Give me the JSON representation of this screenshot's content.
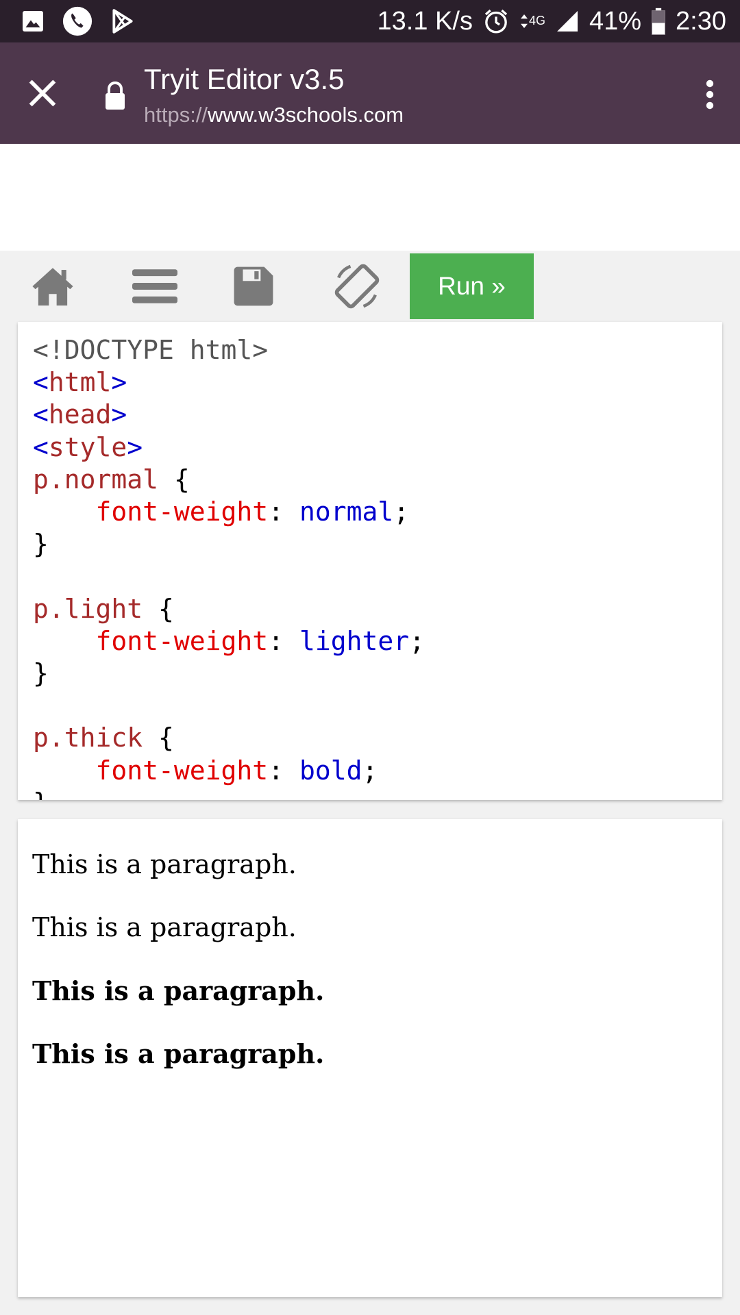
{
  "status_bar": {
    "net_speed": "13.1 K/s",
    "network": "4G",
    "battery": "41%",
    "time": "2:30",
    "icons": [
      "image-icon",
      "phone-icon",
      "play-store-icon",
      "alarm-icon",
      "data-arrows-icon",
      "signal-icon",
      "battery-icon"
    ]
  },
  "browser": {
    "title": "Tryit Editor v3.5",
    "url_scheme": "https://",
    "url_host": "www.w3schools.com"
  },
  "editor_toolbar": {
    "icons": [
      "home-icon",
      "menu-icon",
      "save-icon",
      "rotate-icon"
    ],
    "run_label": "Run »"
  },
  "code": {
    "l1": "<!DOCTYPE html>",
    "l2_open": "<",
    "l2_tag": "html",
    "l2_close": ">",
    "l3_open": "<",
    "l3_tag": "head",
    "l3_close": ">",
    "l4_open": "<",
    "l4_tag": "style",
    "l4_close": ">",
    "normal_sel": "p.normal",
    "normal_prop": "font-weight",
    "normal_val": "normal",
    "light_sel": "p.light",
    "light_prop": "font-weight",
    "light_val": "lighter",
    "thick_sel": "p.thick",
    "thick_prop": "font-weight",
    "thick_val": "bold",
    "brace_open": "{",
    "brace_close": "}"
  },
  "result": {
    "paragraphs": [
      "This is a paragraph.",
      "This is a paragraph.",
      "This is a paragraph.",
      "This is a paragraph."
    ]
  },
  "colors": {
    "status_bar": "#2a1f2b",
    "toolbar": "#4e374c",
    "run_button": "#4caf50"
  }
}
